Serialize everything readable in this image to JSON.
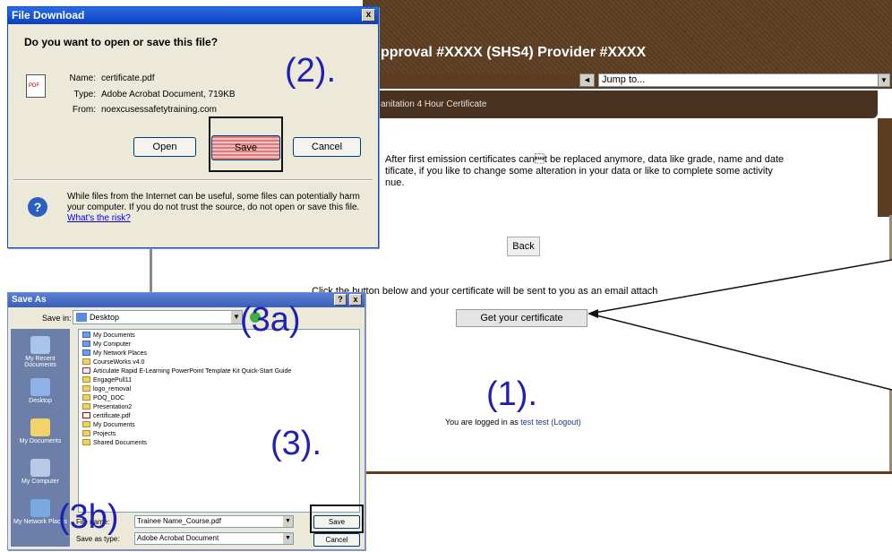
{
  "page": {
    "title": "pproval #XXXX (SHS4) Provider #XXXX",
    "jump_label": "Jump to...",
    "crumb": "anitation 4 Hour Certificate",
    "message_lines": [
      "After first emission certificates can\u0005t be replaced anymore, data like grade, name and date",
      "tificate, if you like to change some alteration in your data or like to complete some activity",
      "nue."
    ],
    "back_label": "Back",
    "instruction": "Click the button below and your certificate will be sent to you as an email attach",
    "get_certificate_label": "Get your certificate",
    "logged_in_prefix": "You are logged in as",
    "user_name": "test test",
    "logout_label": "(Logout)"
  },
  "annotations": {
    "step1": "(1).",
    "step2": "(2).",
    "step3": "(3).",
    "step3a": "(3a)",
    "step3b": "(3b)"
  },
  "file_download": {
    "title": "File Download",
    "question": "Do you want to open or save this file?",
    "fields": [
      {
        "key": "Name:",
        "value": "certificate.pdf"
      },
      {
        "key": "Type:",
        "value": "Adobe Acrobat Document, 719KB"
      },
      {
        "key": "From:",
        "value": "noexcusessafetytraining.com"
      }
    ],
    "open_label": "Open",
    "save_label": "Save",
    "cancel_label": "Cancel",
    "warning": "While files from the Internet can be useful, some files can potentially harm your computer. If you do not trust the source, do not open or save this file.",
    "risk_link": "What's the risk?"
  },
  "save_as": {
    "title": "Save As",
    "save_in_label": "Save in:",
    "save_in_value": "Desktop",
    "places": [
      "My Recent Documents",
      "Desktop",
      "My Documents",
      "My Computer",
      "My Network Places"
    ],
    "files": [
      {
        "name": "My Documents",
        "kind": "sys"
      },
      {
        "name": "My Computer",
        "kind": "sys"
      },
      {
        "name": "My Network Places",
        "kind": "sys"
      },
      {
        "name": "CourseWorks v4.0",
        "kind": "folder"
      },
      {
        "name": "Articulate Rapid E-Learning PowerPoint Template Kit Quick-Start Guide",
        "kind": "doc"
      },
      {
        "name": "EngagePull11",
        "kind": "folder"
      },
      {
        "name": "logo_removal",
        "kind": "folder"
      },
      {
        "name": "POQ_DOC",
        "kind": "folder"
      },
      {
        "name": "Presentation2",
        "kind": "folder"
      },
      {
        "name": "certificate.pdf",
        "kind": "pdf"
      },
      {
        "name": "My Documents",
        "kind": "folder"
      },
      {
        "name": "Projects",
        "kind": "folder"
      },
      {
        "name": "Shared Documents",
        "kind": "folder"
      }
    ],
    "file_name_label": "File name:",
    "file_name_value": "Trainee Name_Course.pdf",
    "save_type_label": "Save as type:",
    "save_type_value": "Adobe Acrobat Document",
    "save_label": "Save",
    "cancel_label": "Cancel"
  }
}
